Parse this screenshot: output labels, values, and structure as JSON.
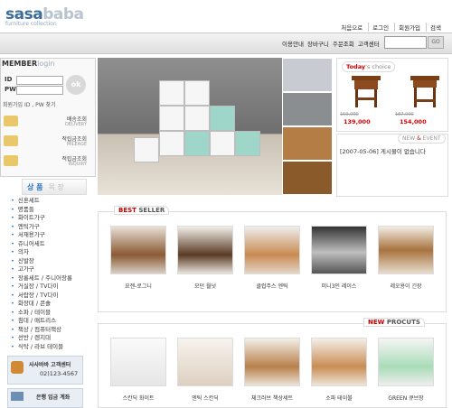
{
  "logo": {
    "word1": "sasa",
    "word2": "baba",
    "tagline": "furniture collection"
  },
  "top_nav": [
    "처음으로",
    "로그인",
    "회원가입",
    "검색"
  ],
  "main_nav": [
    "이용안내",
    "장바구니",
    "주문조회",
    "고객센터"
  ],
  "search": {
    "go_label": "GO"
  },
  "login": {
    "title": "MEMBER",
    "title_sub": "login",
    "id_label": "ID",
    "pw_label": "PW",
    "ok_label": "ok",
    "links": "회원가입   ID , PW 찾기"
  },
  "side_buttons": [
    {
      "label": "배송조회",
      "sub": "DELIVERY"
    },
    {
      "label": "적립금조회",
      "sub": "MILEAGE"
    },
    {
      "label": "적립금조회",
      "sub": "INQUIRY"
    }
  ],
  "category": {
    "title": "상 품",
    "title_sub": "목 장",
    "items": [
      "신혼세트",
      "명품들",
      "화이트가구",
      "엔틱가구",
      "서재용가구",
      "쥬니어세트",
      "의자",
      "신발장",
      "고가구",
      "장롱세트 / 주니어장롱",
      "거실장 / TV다이",
      "서랍장 / TV다이",
      "화장대 / 콘솔",
      "소파 / 테이블",
      "침대 / 매트리스",
      "책상 / 컴퓨터책상",
      "선반 / 렌지대",
      "식탁 / 라브 테이블"
    ]
  },
  "customer_center": {
    "title": "사사바바 고객센터",
    "phone": "02)123-4567"
  },
  "bank": {
    "title": "은행 입금 계좌"
  },
  "today_choice": {
    "title": "Today",
    "title_sub": "'s choice",
    "items": [
      {
        "old_price": "159,000",
        "new_price": "139,000"
      },
      {
        "old_price": "187,000",
        "new_price": "154,000"
      }
    ]
  },
  "news": {
    "title_a": "NEW",
    "title_amp": "&",
    "title_b": "EVENT",
    "item": "[2007-05-06]  게시물이 없습니다"
  },
  "best_seller": {
    "title_hl": "BEST",
    "title_rest": "SELLER",
    "products": [
      {
        "name": "요젠-로그니"
      },
      {
        "name": "모던 월넛"
      },
      {
        "name": "클럽주스 엔틱"
      },
      {
        "name": "미니3인 레이스"
      },
      {
        "name": "레오용이 긴장"
      }
    ]
  },
  "new_products": {
    "title_hl": "NEW",
    "title_rest": "PROCUTS",
    "products": [
      {
        "name": "스칸딕 화이트"
      },
      {
        "name": "엔틱 스칸딕"
      },
      {
        "name": "체크러브 책상세트"
      },
      {
        "name": "소파 테이블"
      },
      {
        "name": "GREEN 큐브장"
      }
    ]
  }
}
